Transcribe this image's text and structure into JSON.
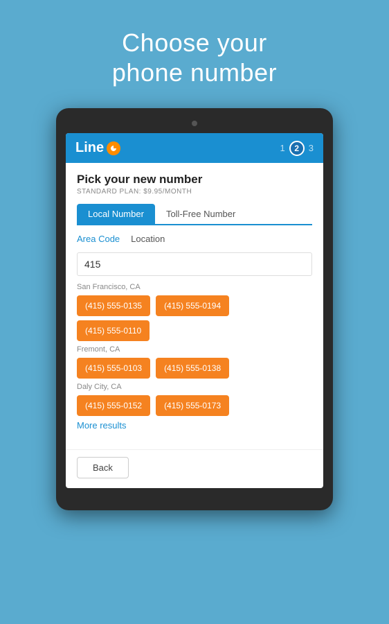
{
  "headline": {
    "line1": "Choose your",
    "line2": "phone number"
  },
  "header": {
    "logo_text": "Line",
    "steps": [
      {
        "label": "1",
        "active": false
      },
      {
        "label": "2",
        "active": true
      },
      {
        "label": "3",
        "active": false
      }
    ]
  },
  "app": {
    "pick_title": "Pick your new number",
    "plan_label": "STANDARD PLAN: $9.95/MONTH",
    "tabs": [
      {
        "label": "Local Number",
        "active": true
      },
      {
        "label": "Toll-Free Number",
        "active": false
      }
    ],
    "subtabs": [
      {
        "label": "Area Code",
        "active": true
      },
      {
        "label": "Location",
        "active": false
      }
    ],
    "search_value": "415",
    "search_placeholder": "415",
    "locations": [
      {
        "name": "San Francisco, CA",
        "numbers": [
          "(415) 555-0135",
          "(415) 555-0194",
          "(415) 555-0110"
        ]
      },
      {
        "name": "Fremont, CA",
        "numbers": [
          "(415) 555-0103",
          "(415) 555-0138"
        ]
      },
      {
        "name": "Daly City, CA",
        "numbers": [
          "(415) 555-0152",
          "(415) 555-0173"
        ]
      }
    ],
    "more_results_label": "More results",
    "back_button_label": "Back"
  }
}
